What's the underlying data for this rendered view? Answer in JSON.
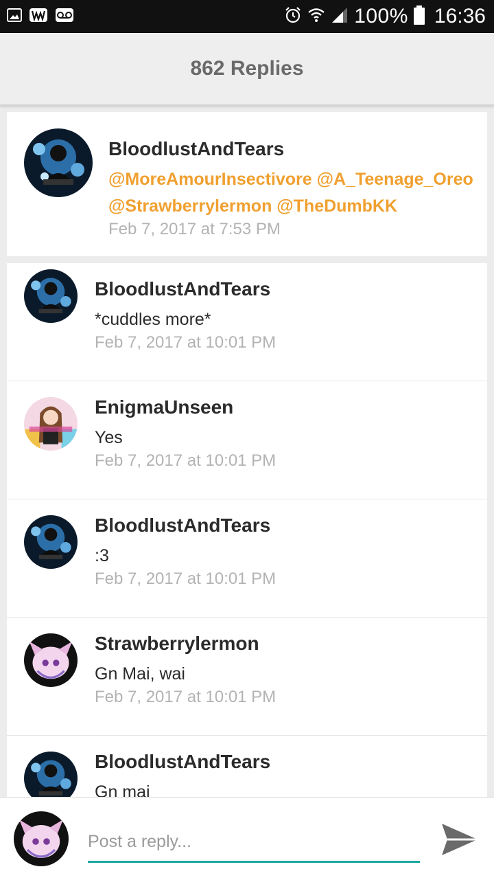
{
  "status_bar": {
    "battery": "100%",
    "time": "16:36"
  },
  "header": {
    "title": "862 Replies"
  },
  "original_post": {
    "username": "BloodlustAndTears",
    "mentions_line1": "@MoreAmourInsectivore @A_Teenage_Oreo",
    "mentions_line2": "@Strawberrylermon @TheDumbKK",
    "timestamp": "Feb 7, 2017 at 7:53 PM"
  },
  "replies": [
    {
      "username": "BloodlustAndTears",
      "message": "*cuddles more*",
      "timestamp": "Feb 7, 2017 at 10:01 PM"
    },
    {
      "username": "EnigmaUnseen",
      "message": "Yes",
      "timestamp": "Feb 7, 2017 at 10:01 PM"
    },
    {
      "username": "BloodlustAndTears",
      "message": ":3",
      "timestamp": "Feb 7, 2017 at 10:01 PM"
    },
    {
      "username": "Strawberrylermon",
      "message": "Gn Mai, wai",
      "timestamp": "Feb 7, 2017 at 10:01 PM"
    },
    {
      "username": "BloodlustAndTears",
      "message": "Gn mai",
      "timestamp": ""
    }
  ],
  "reply_bar": {
    "placeholder": "Post a reply...",
    "accent_color": "#1aa7a1"
  },
  "colors": {
    "mention": "#f0a030",
    "timestamp": "#b3b3b3"
  }
}
